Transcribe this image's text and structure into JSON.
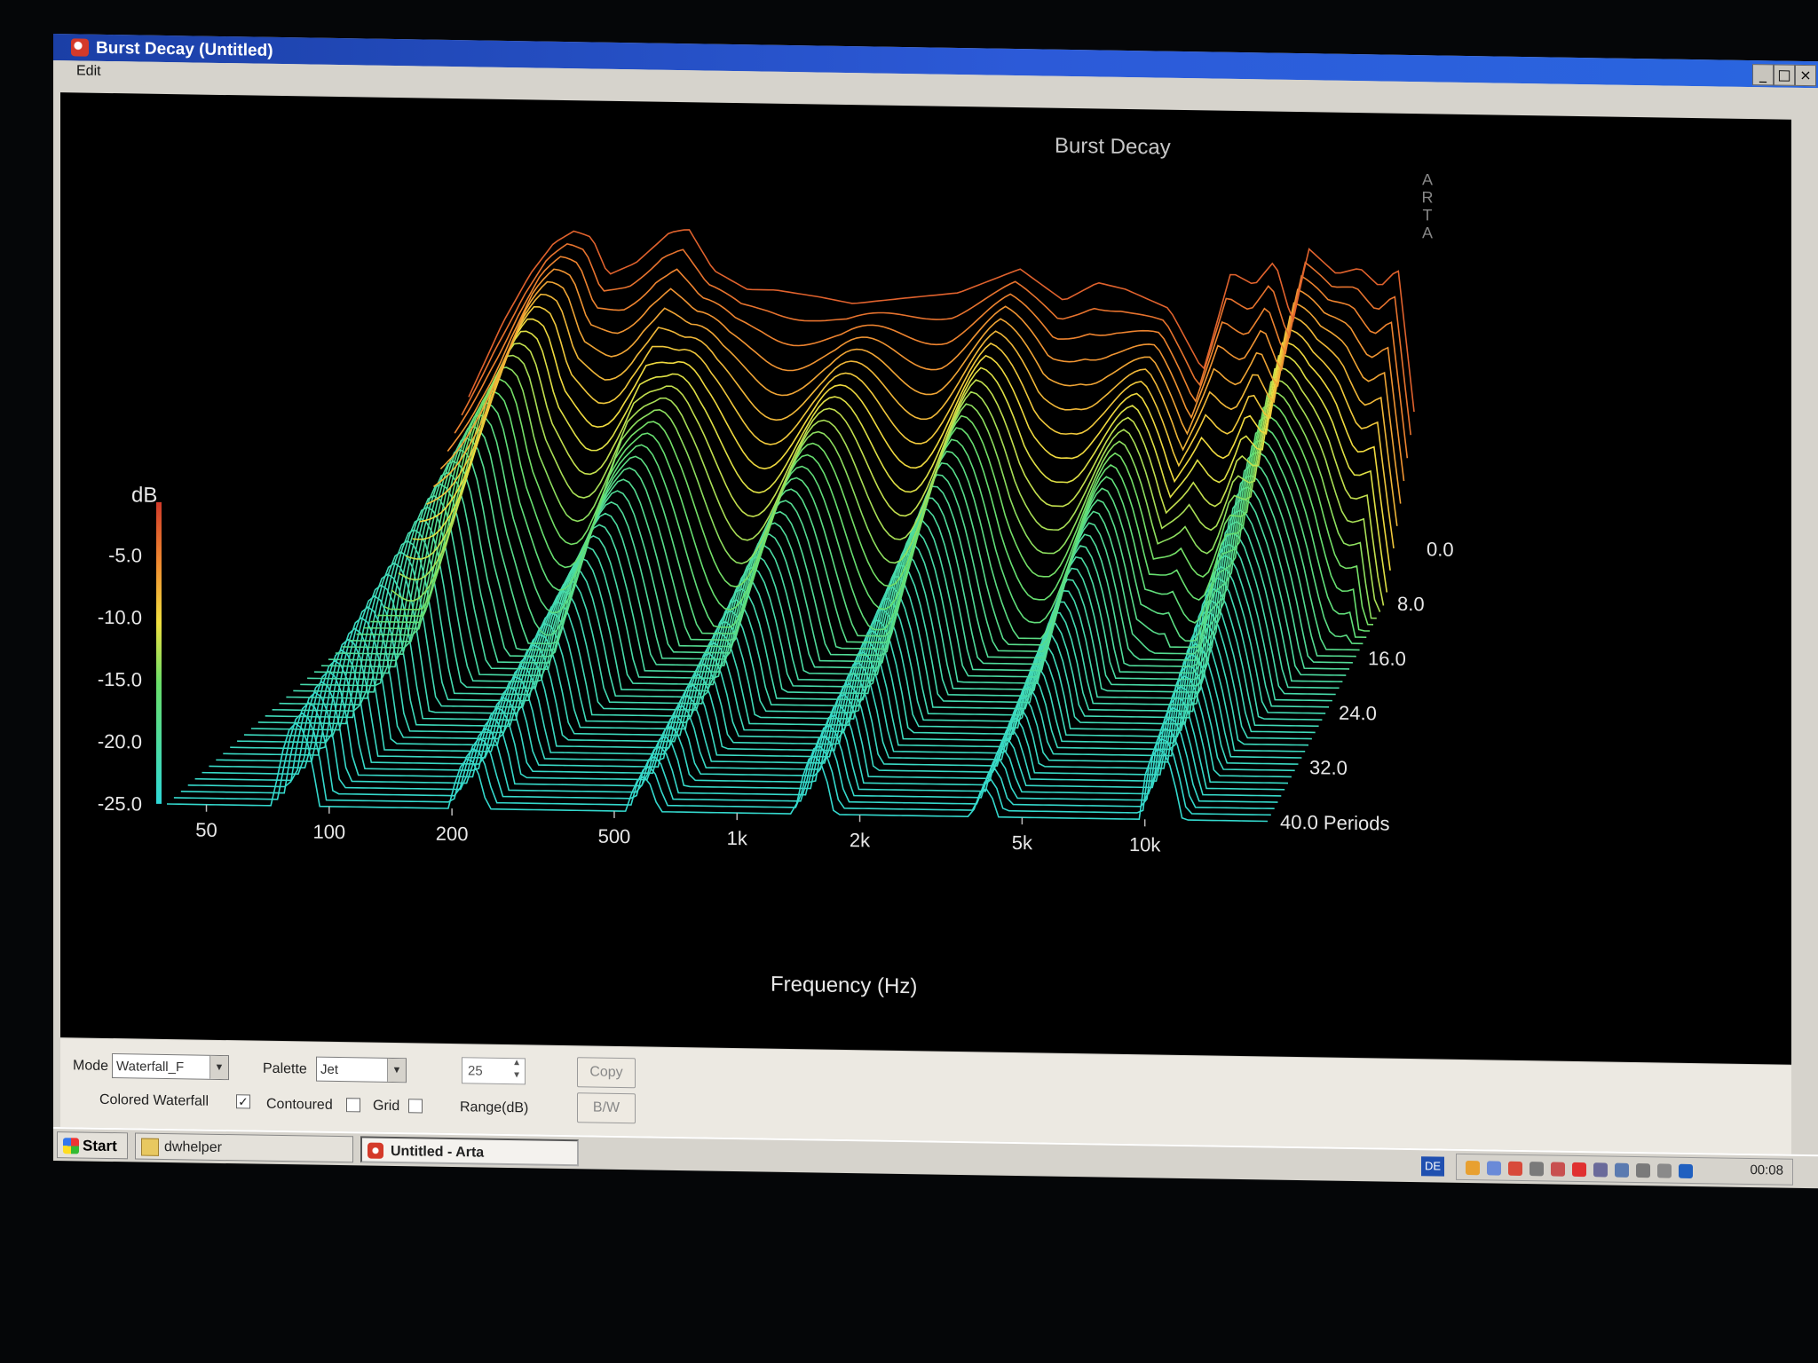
{
  "window": {
    "title": "Burst Decay  (Untitled)",
    "menu": [
      "Edit"
    ],
    "buttons": {
      "minimize": "_",
      "maximize": "□",
      "close": "×"
    }
  },
  "chart_data": {
    "type": "waterfall",
    "title": "Burst Decay",
    "watermark": "ARTA",
    "xlabel": "Frequency (Hz)",
    "x_scale": "log",
    "x_ticks": [
      "50",
      "100",
      "200",
      "500",
      "1k",
      "2k",
      "5k",
      "10k"
    ],
    "x_tick_values": [
      50,
      100,
      200,
      500,
      1000,
      2000,
      5000,
      10000
    ],
    "ylabel": "dB",
    "y_ticks": [
      "-5.0",
      "-10.0",
      "-15.0",
      "-20.0",
      "-25.0"
    ],
    "ylim": [
      -25,
      0
    ],
    "z_ticks": [
      "0.0",
      "8.0",
      "16.0",
      "24.0",
      "32.0",
      "40.0 Periods"
    ],
    "zlim": [
      0,
      40
    ],
    "palette": "Jet",
    "front_response": {
      "freq_hz": [
        40,
        50,
        60,
        70,
        80,
        90,
        100,
        120,
        150,
        170,
        200,
        250,
        300,
        400,
        500,
        700,
        1000,
        1500,
        2000,
        2500,
        3000,
        4000,
        5000,
        6000,
        7000,
        8000,
        9000,
        10000,
        12000,
        14000,
        16000,
        18000,
        20000
      ],
      "level_db": [
        -14,
        -8,
        -4,
        -1.5,
        -0.5,
        -1,
        -4,
        -3,
        -0.5,
        -0.2,
        -3.5,
        -5,
        -5,
        -5.5,
        -6,
        -5.5,
        -5,
        -3,
        -5.5,
        -4,
        -4.5,
        -6,
        -11,
        -3,
        -4,
        -2,
        -7,
        -1,
        -3,
        -2.5,
        -4,
        -2.5,
        -14
      ]
    }
  },
  "controls": {
    "mode_label": "Mode",
    "mode_value": "Waterfall_F",
    "palette_label": "Palette",
    "palette_value": "Jet",
    "range_value": "25",
    "range_label": "Range(dB)",
    "copy_label": "Copy",
    "bw_label": "B/W",
    "colored_waterfall_label": "Colored Waterfall",
    "colored_waterfall_checked": true,
    "contoured_label": "Contoured",
    "contoured_checked": false,
    "grid_label": "Grid",
    "grid_checked": false
  },
  "taskbar": {
    "start_label": "Start",
    "tasks": [
      {
        "label": "dwhelper",
        "active": false
      },
      {
        "label": "Untitled - Arta",
        "active": true
      }
    ],
    "language": "DE",
    "clock": "00:08"
  }
}
